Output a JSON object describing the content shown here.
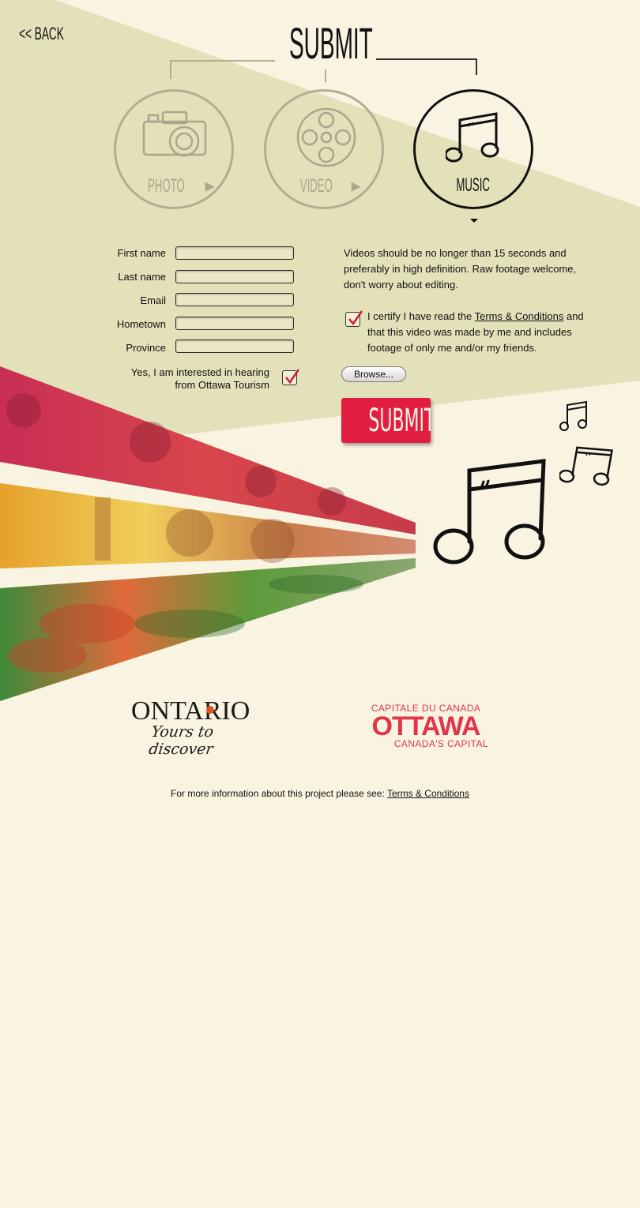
{
  "header": {
    "back_label": "<< BACK",
    "title": "SUBMIT"
  },
  "categories": [
    {
      "label": "PHOTO",
      "icon": "camera-icon",
      "active": false
    },
    {
      "label": "VIDEO",
      "icon": "film-reel-icon",
      "active": false
    },
    {
      "label": "MUSIC",
      "icon": "music-note-icon",
      "active": true
    }
  ],
  "form": {
    "fields": [
      {
        "label": "First name",
        "value": ""
      },
      {
        "label": "Last name",
        "value": ""
      },
      {
        "label": "Email",
        "value": ""
      },
      {
        "label": "Hometown",
        "value": ""
      },
      {
        "label": "Province",
        "value": ""
      }
    ],
    "optin_label_line1": "Yes, I am interested in hearing",
    "optin_label_line2": "from Ottawa Tourism",
    "optin_checked": true
  },
  "upload": {
    "instructions_line1": "Videos should be no longer than 15 seconds and",
    "instructions_line2": "preferably in high definition. Raw footage welcome,",
    "instructions_line3": "don't worry about editing.",
    "certify_prefix": "I certify I have read the",
    "certify_link": "Terms & Conditions",
    "certify_suffix": "and",
    "certify_line2": "that this video was made by me and includes",
    "certify_line3": "footage of only me and/or my friends.",
    "certify_checked": true,
    "browse_label": "Browse...",
    "submit_label": "SUBMIT"
  },
  "logos": {
    "ontario_name": "ONTARIO",
    "ontario_tagline": "Yours to discover",
    "ottawa_top": "CAPITALE DU CANADA",
    "ottawa_name": "OTTAWA",
    "ottawa_bottom": "CANADA'S CAPITAL"
  },
  "footer": {
    "text": "For more information about this project please see:",
    "link": "Terms & Conditions"
  },
  "colors": {
    "background": "#f8f4e1",
    "wedge": "#e3e1b9",
    "accent_red": "#e21d42",
    "inactive_gray": "#b3ad92"
  }
}
